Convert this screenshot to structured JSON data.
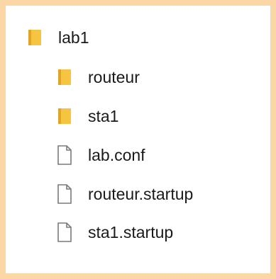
{
  "tree": {
    "root": {
      "label": "lab1",
      "icon": "folder-icon"
    },
    "children": [
      {
        "label": "routeur",
        "icon": "folder-icon"
      },
      {
        "label": "sta1",
        "icon": "folder-icon"
      },
      {
        "label": "lab.conf",
        "icon": "file-icon"
      },
      {
        "label": "routeur.startup",
        "icon": "file-icon"
      },
      {
        "label": "sta1.startup",
        "icon": "file-icon"
      }
    ]
  },
  "colors": {
    "background": "#fbd7a6",
    "panel": "#ffffff",
    "folder": "#f5c542",
    "folder_dark": "#e0a526",
    "file_outline": "#7a7a7a",
    "text": "#1a1a1a"
  }
}
